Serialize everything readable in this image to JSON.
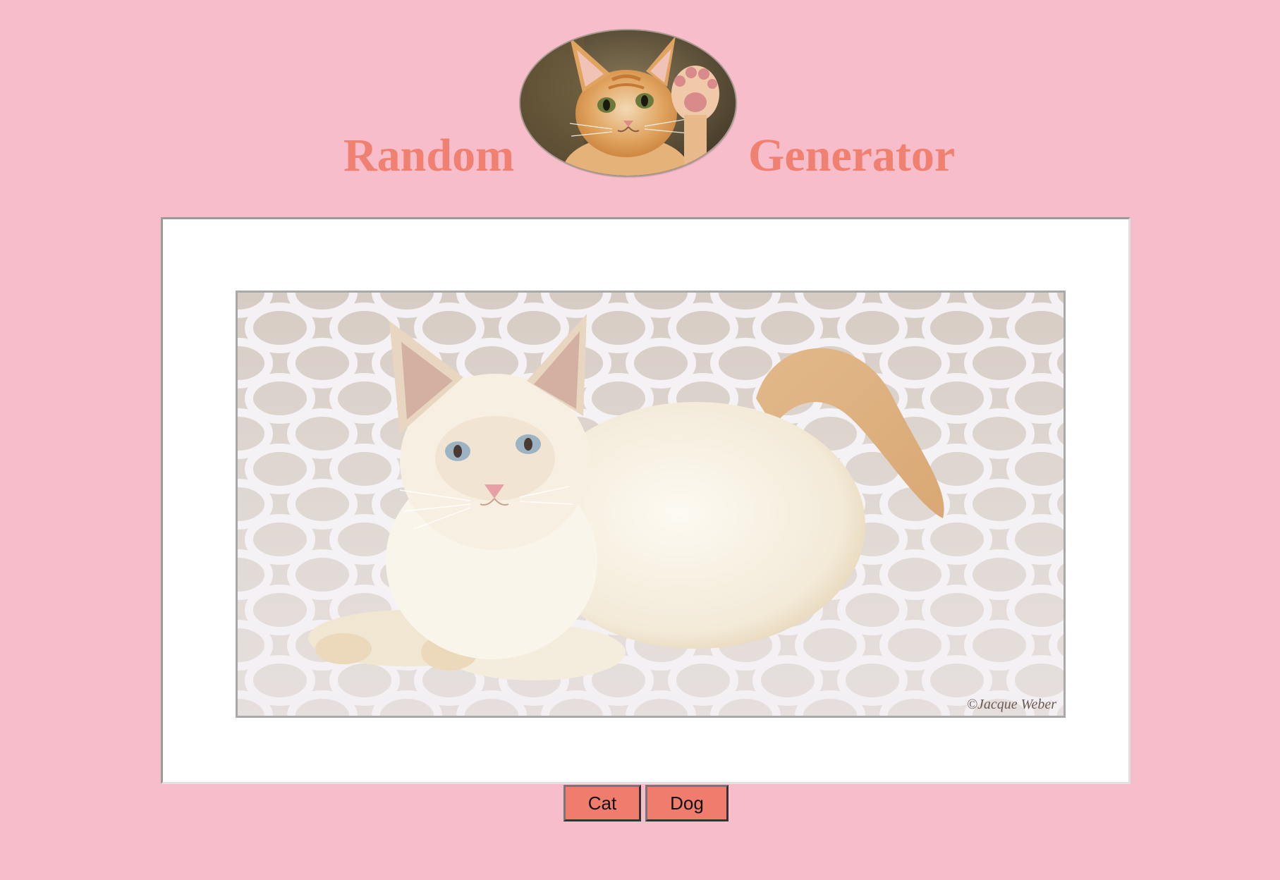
{
  "header": {
    "title_left": "Random",
    "title_right": "Generator",
    "logo_alt": "kitten waving paw"
  },
  "image": {
    "description_alt": "white cat lying on patterned blanket",
    "watermark": "©Jacque Weber"
  },
  "buttons": {
    "cat_label": "Cat",
    "dog_label": "Dog"
  },
  "colors": {
    "background": "#f7bdca",
    "title": "#f08070",
    "button": "#f07c6e",
    "frame": "#ffffff"
  }
}
